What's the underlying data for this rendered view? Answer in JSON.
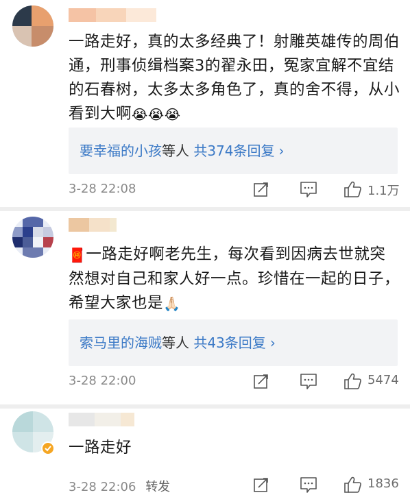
{
  "comments": [
    {
      "text": "一路走好，真的太多经典了！射雕英雄传的周伯通，刑事侦缉档案3的翟永田，冤家宜解不宜结的石春树，太多太多角色了，真的舍不得，从小看到大啊",
      "emoji": "😭😭😭",
      "reply": {
        "names": "要幸福的小孩",
        "mid": "等人 ",
        "count": "共374条回复",
        "chevron": "›"
      },
      "time": "3-28 22:08",
      "likes": "1.1万"
    },
    {
      "prefix_emoji": "🧧",
      "text": "一路走好啊老先生，每次看到因病去世就突然想对自己和家人好一点。珍惜在一起的日子，希望大家也是",
      "emoji": "🙏🏻",
      "reply": {
        "names": "索马里的海贼",
        "mid": "等人 ",
        "count": "共43条回复",
        "chevron": "›"
      },
      "time": "3-28 22:00",
      "likes": "5474"
    },
    {
      "text": "一路走好",
      "time": "3-28 22:06",
      "repost": "转发",
      "likes": "1836"
    }
  ],
  "icons": {
    "share": "share-icon",
    "comment": "comment-icon",
    "like": "thumbs-up-icon"
  },
  "colors": {
    "link": "#3b79c6",
    "meta": "#8a8a8a",
    "reply_bg": "#f2f3f5"
  }
}
